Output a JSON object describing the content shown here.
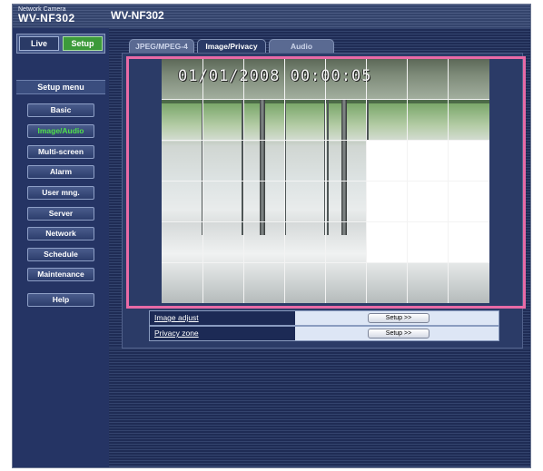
{
  "header": {
    "brand_small": "Network Camera",
    "brand_model": "WV-NF302",
    "title": "WV-NF302"
  },
  "mode": {
    "live_label": "Live",
    "setup_label": "Setup"
  },
  "sidebar": {
    "heading": "Setup menu",
    "items": [
      {
        "label": "Basic"
      },
      {
        "label": "Image/Audio"
      },
      {
        "label": "Multi-screen"
      },
      {
        "label": "Alarm"
      },
      {
        "label": "User mng."
      },
      {
        "label": "Server"
      },
      {
        "label": "Network"
      },
      {
        "label": "Schedule"
      },
      {
        "label": "Maintenance"
      }
    ],
    "help_label": "Help",
    "active_item": "Image/Audio"
  },
  "tabs": [
    {
      "label": "JPEG/MPEG-4"
    },
    {
      "label": "Image/Privacy"
    },
    {
      "label": "Audio"
    }
  ],
  "active_tab": "Image/Privacy",
  "camera": {
    "timestamp": "01/01/2008 00:00:05"
  },
  "settings": {
    "rows": [
      {
        "label": "Image adjust",
        "button": "Setup >>"
      },
      {
        "label": "Privacy zone",
        "button": "Setup >>"
      }
    ]
  },
  "colors": {
    "active_green": "#3c9a3a",
    "active_text_green": "#4fe04a",
    "highlight_pink": "#e86aa6",
    "panel_navy": "#1e2a4d"
  }
}
